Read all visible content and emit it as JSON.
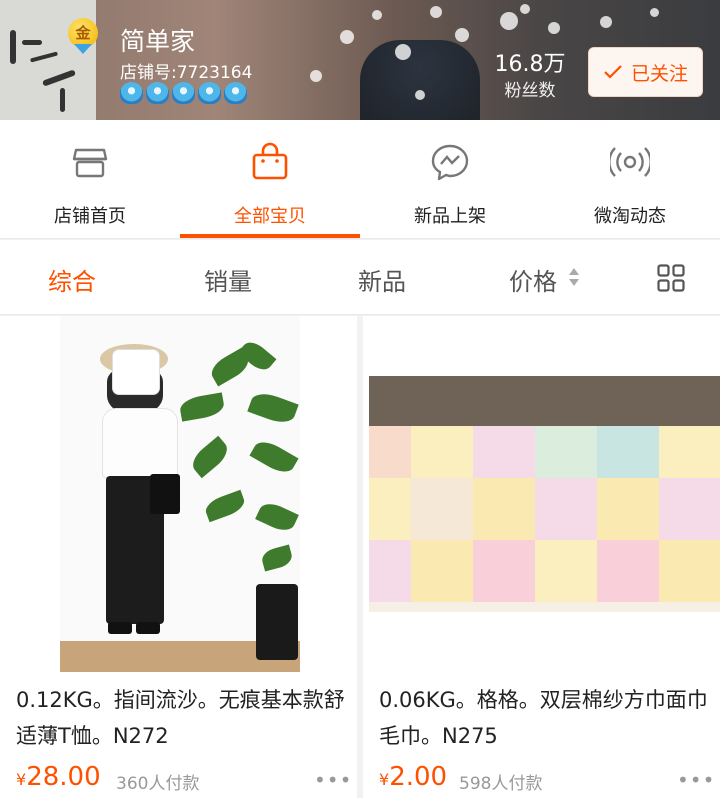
{
  "shop": {
    "name": "简单家",
    "shop_id": "店铺号:7723164",
    "badge": "金",
    "crown_count": 5,
    "fans_count": "16.8万",
    "fans_label": "粉丝数",
    "follow_label": "已关注"
  },
  "nav": {
    "items": [
      {
        "label": "店铺首页",
        "icon": "store-icon"
      },
      {
        "label": "全部宝贝",
        "icon": "bag-icon"
      },
      {
        "label": "新品上架",
        "icon": "chat-icon"
      },
      {
        "label": "微淘动态",
        "icon": "broadcast-icon"
      }
    ],
    "active_index": 1
  },
  "sort": {
    "options": [
      "综合",
      "销量",
      "新品",
      "价格"
    ],
    "active_index": 0,
    "layout_toggle_icon": "grid-view-icon"
  },
  "products": [
    {
      "title": "0.12KG。指间流沙。无痕基本款舒适薄T恤。N272",
      "currency": "¥",
      "price": "28.00",
      "sold": "360人付款",
      "more": "•••"
    },
    {
      "title": "0.06KG。格格。双层棉纱方巾面巾毛巾。N275",
      "currency": "¥",
      "price": "2.00",
      "sold": "598人付款",
      "more": "•••"
    }
  ],
  "colors": {
    "accent": "#ff5000",
    "muted": "#999999"
  }
}
